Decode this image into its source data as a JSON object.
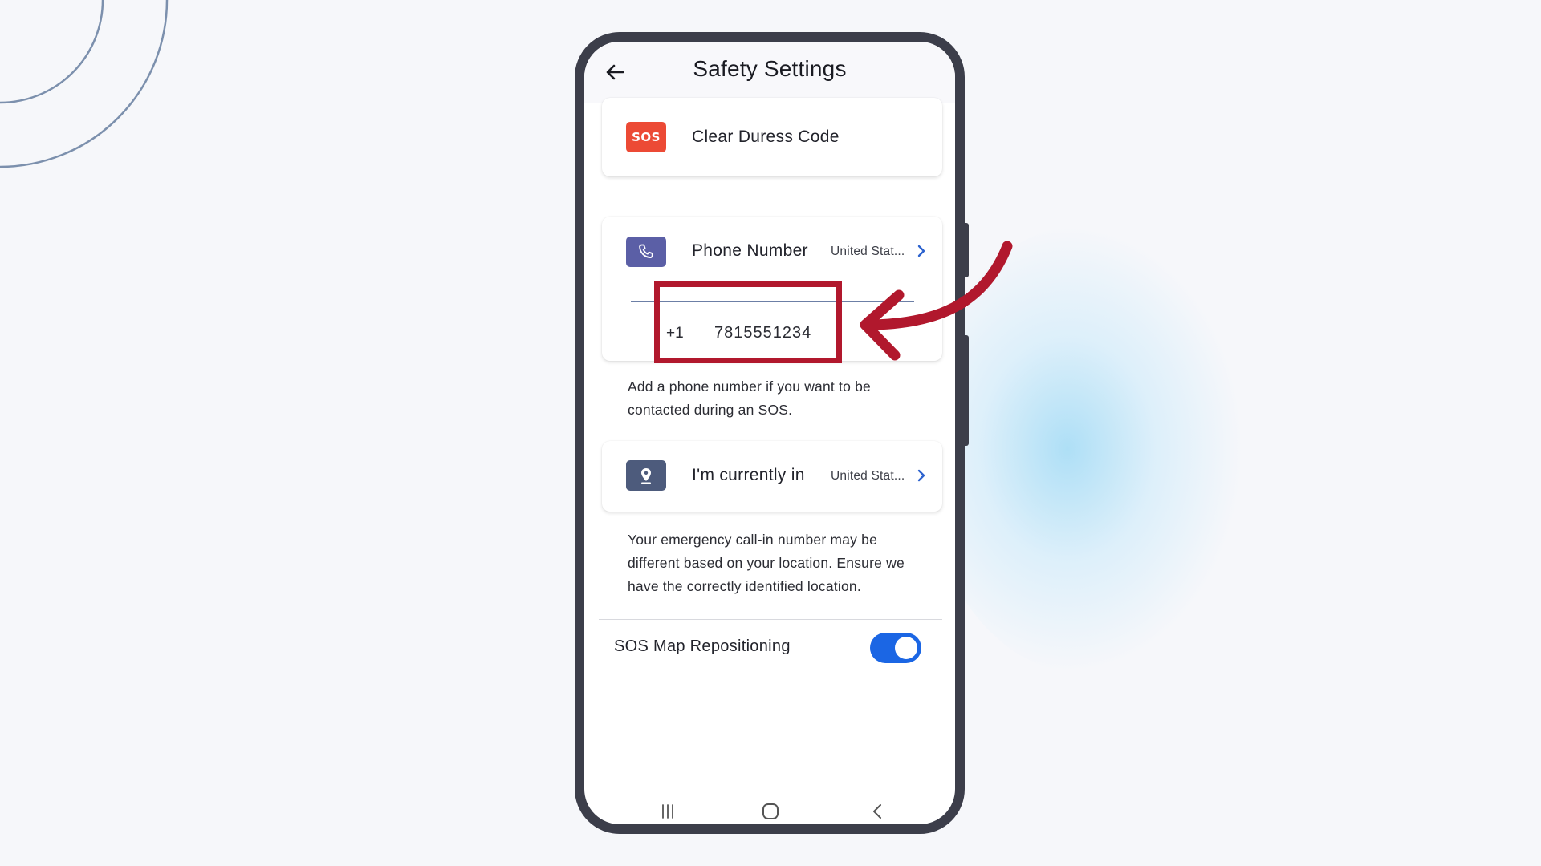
{
  "header": {
    "title": "Safety Settings"
  },
  "duress": {
    "badge": "SOS",
    "label": "Clear Duress Code"
  },
  "phone": {
    "label": "Phone Number",
    "country": "United Stat...",
    "prefix": "+1",
    "number": "7815551234",
    "helper": "Add a phone number if you want to be contacted during an SOS."
  },
  "location": {
    "label": "I'm currently in",
    "country": "United Stat...",
    "helper": "Your emergency call-in number may be different based on your location. Ensure we have the correctly identified location."
  },
  "sos_map": {
    "label": "SOS Map Repositioning",
    "enabled": true
  },
  "colors": {
    "sos_red": "#ec4a35",
    "phone_purple": "#5b5fa6",
    "location_slate": "#4d5b7c",
    "toggle_blue": "#1b66e4",
    "callout_red": "#b1182d"
  },
  "icons": {
    "back": "arrow-left-icon",
    "phone": "phone-icon",
    "location": "map-pin-icon",
    "chevron": "chevron-right-icon",
    "nav_recent": "recent-apps-icon",
    "nav_home": "home-icon",
    "nav_back": "nav-back-icon"
  }
}
